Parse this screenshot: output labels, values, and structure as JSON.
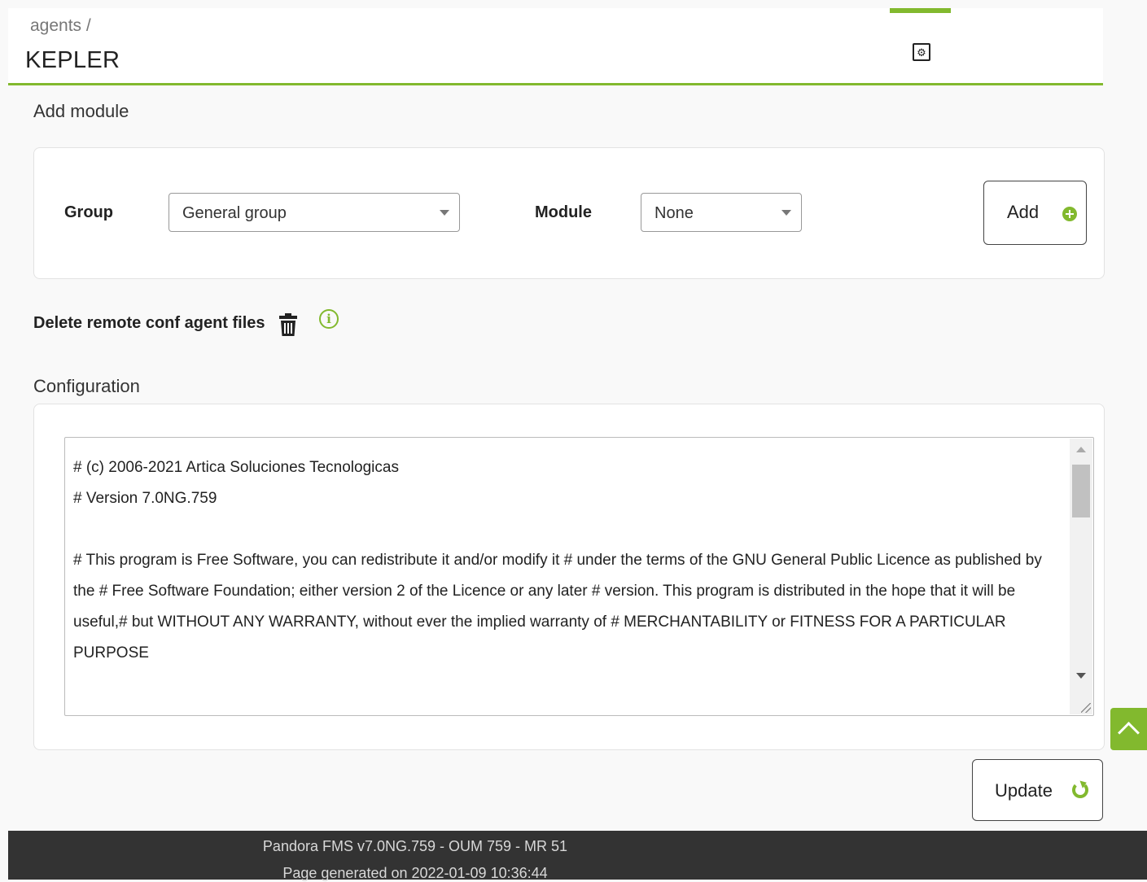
{
  "header": {
    "breadcrumb": "agents /",
    "title": "KEPLER",
    "setup_tab_icon": "gear-icon",
    "accent_color": "#82b92e"
  },
  "add_module": {
    "title": "Add module",
    "group_label": "Group",
    "group_value": "General group",
    "module_label": "Module",
    "module_value": "None",
    "add_button": "Add"
  },
  "delete_remote": {
    "label": "Delete remote conf agent files",
    "trash_icon": "trash-icon",
    "info_icon": "info-icon"
  },
  "configuration": {
    "title": "Configuration",
    "text": "# (c) 2006-2021 Artica Soluciones Tecnologicas\n# Version 7.0NG.759\n\n# This program is Free Software, you can redistribute it and/or modify it # under the terms of the GNU General Public Licence as published by the # Free Software Foundation; either version 2 of the Licence or any later # version. This program is distributed in the hope that it will be useful,# but WITHOUT ANY WARRANTY, without ever the implied warranty of # MERCHANTABILITY or FITNESS FOR A PARTICULAR PURPOSE"
  },
  "actions": {
    "update_button": "Update"
  },
  "footer": {
    "version": "Pandora FMS v7.0NG.759 - OUM 759 - MR 51",
    "generated": "Page generated on 2022-01-09 10:36:44"
  }
}
